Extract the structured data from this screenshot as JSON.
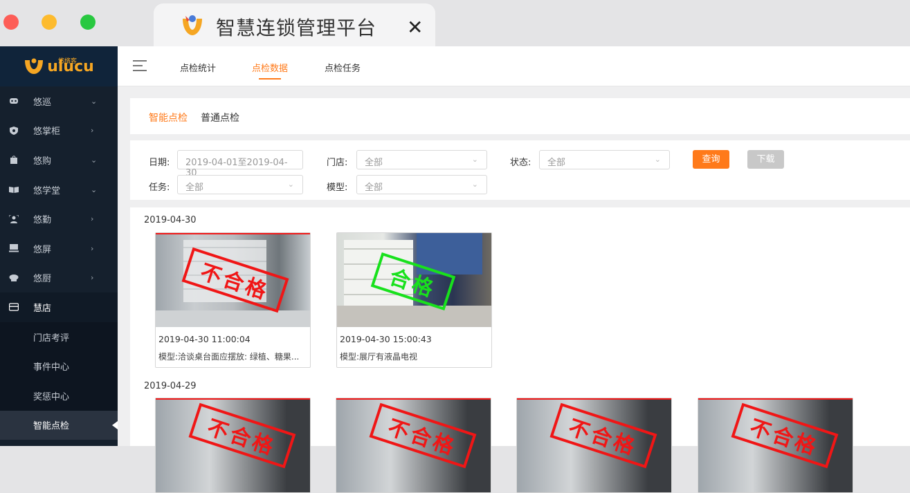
{
  "browser": {
    "tab_title": "智慧连锁管理平台",
    "close_glyph": "✕"
  },
  "sidebar": {
    "brand": "ulucu",
    "brand_sub": "悠络客",
    "items": [
      {
        "label": "悠巡",
        "arrow": "⌄"
      },
      {
        "label": "悠掌柜",
        "arrow": "›"
      },
      {
        "label": "悠购",
        "arrow": "⌄"
      },
      {
        "label": "悠学堂",
        "arrow": "⌄"
      },
      {
        "label": "悠勤",
        "arrow": "›"
      },
      {
        "label": "悠屏",
        "arrow": "›"
      },
      {
        "label": "悠厨",
        "arrow": "›"
      },
      {
        "label": "慧店",
        "arrow": ""
      }
    ],
    "sub_items": [
      {
        "label": "门店考评"
      },
      {
        "label": "事件中心"
      },
      {
        "label": "奖惩中心"
      },
      {
        "label": "智能点检"
      }
    ]
  },
  "topbar": {
    "tabs": [
      {
        "label": "点检统计"
      },
      {
        "label": "点检数据"
      },
      {
        "label": "点检任务"
      }
    ],
    "active_tab": "点检数据"
  },
  "panel_tabs": {
    "tabs": [
      {
        "label": "智能点检"
      },
      {
        "label": "普通点检"
      }
    ]
  },
  "filters": {
    "date_label": "日期:",
    "date_value": "2019-04-01至2019-04-30",
    "store_label": "门店:",
    "store_value": "全部",
    "status_label": "状态:",
    "status_value": "全部",
    "task_label": "任务:",
    "task_value": "全部",
    "model_label": "模型:",
    "model_value": "全部",
    "query_button": "查询",
    "download_button": "下载"
  },
  "groups": [
    {
      "date": "2019-04-30",
      "cards": [
        {
          "time": "2019-04-30 11:00:04",
          "model": "模型:洽谈桌台面应摆放: 绿植、糖果...",
          "stamp": "不合格",
          "result": "fail"
        },
        {
          "time": "2019-04-30 15:00:43",
          "model": "模型:展厅有液晶电视",
          "stamp": "合格",
          "result": "pass"
        }
      ]
    },
    {
      "date": "2019-04-29",
      "cards": [
        {
          "stamp": "不合格",
          "result": "fail"
        },
        {
          "stamp": "不合格",
          "result": "fail"
        },
        {
          "stamp": "不合格",
          "result": "fail"
        },
        {
          "stamp": "不合格",
          "result": "fail"
        }
      ]
    }
  ],
  "colors": {
    "accent": "#ff7a1a",
    "sidebar_bg": "#15202d",
    "fail": "#f01616",
    "pass": "#18e11c"
  }
}
